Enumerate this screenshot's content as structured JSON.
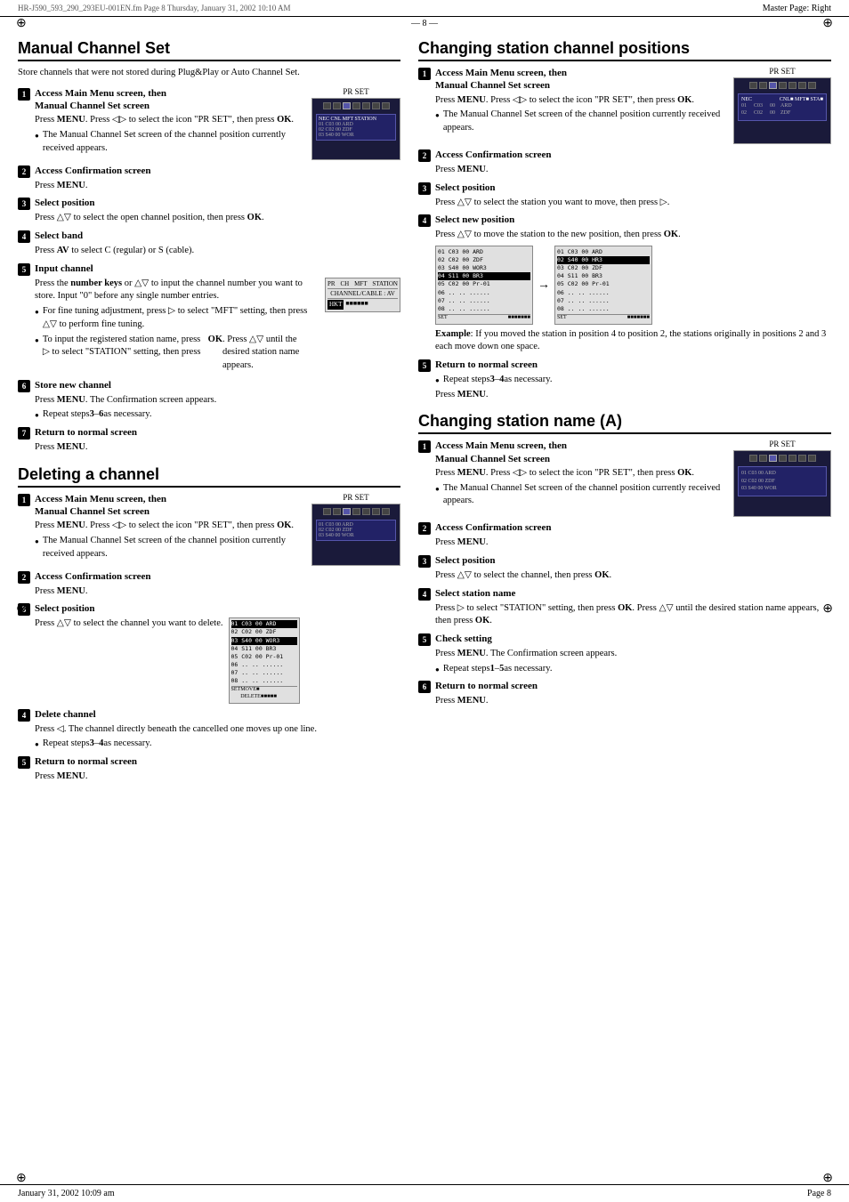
{
  "header": {
    "master_page": "Master Page: Right",
    "file_info": "HR-J590_593_290_293EU-001EN.fm  Page 8  Thursday, January 31, 2002  10:10 AM"
  },
  "footer": {
    "date": "January 31, 2002 10:09 am",
    "page_num": "Page 8",
    "page_dash": "— 8 —"
  },
  "left": {
    "manual_channel_set": {
      "title": "Manual Channel Set",
      "intro": "Store channels that were not stored during Plug&Play or Auto Channel Set.",
      "steps": [
        {
          "num": "1",
          "title": "Access Main Menu screen, then Manual Channel Set screen",
          "body": "Press MENU. Press ◁▷ to select the icon \"PR SET\", then press OK.",
          "bullet": "The Manual Channel Set screen of the channel position currently received appears."
        },
        {
          "num": "2",
          "title": "Access Confirmation screen",
          "body": "Press MENU."
        },
        {
          "num": "3",
          "title": "Select position",
          "body": "Press △▽ to select the open channel position, then press OK."
        },
        {
          "num": "4",
          "title": "Select band",
          "body": "Press AV to select C (regular) or S (cable)."
        },
        {
          "num": "5",
          "title": "Input channel",
          "body1": "Press the number keys or △▽ to input the channel number you want to store. Input \"0\" before any single number entries.",
          "bullet1": "For fine tuning adjustment, press ▷ to select \"MFT\" setting, then press △▽ to perform fine tuning.",
          "bullet2": "To input the registered station name, press ▷ to select \"STATION\" setting, then press OK. Press △▽ until the desired station name appears."
        },
        {
          "num": "6",
          "title": "Store new channel",
          "body": "Press MENU. The Confirmation screen appears.",
          "bullet": "Repeat steps 3 – 6 as necessary."
        },
        {
          "num": "7",
          "title": "Return to normal screen",
          "body": "Press MENU."
        }
      ]
    },
    "deleting_channel": {
      "title": "Deleting a channel",
      "steps": [
        {
          "num": "1",
          "title": "Access Main Menu screen, then Manual Channel Set screen",
          "body": "Press MENU. Press ◁▷ to select the icon \"PR SET\", then press OK.",
          "bullet": "The Manual Channel Set screen of the channel position currently received appears."
        },
        {
          "num": "2",
          "title": "Access Confirmation screen",
          "body": "Press MENU."
        },
        {
          "num": "3",
          "title": "Select position",
          "body": "Press △▽ to select the channel you want to delete."
        },
        {
          "num": "4",
          "title": "Delete channel",
          "body": "Press ◁. The channel directly beneath the cancelled one moves up one line.",
          "bullet": "Repeat steps 3 – 4 as necessary."
        },
        {
          "num": "5",
          "title": "Return to normal screen",
          "body": "Press MENU."
        }
      ]
    }
  },
  "right": {
    "changing_positions": {
      "title": "Changing station channel positions",
      "steps": [
        {
          "num": "1",
          "title": "Access Main Menu screen, then Manual Channel Set screen",
          "body": "Press MENU. Press ◁▷ to select the icon \"PR SET\", then press OK.",
          "bullet": "The Manual Channel Set screen of the channel position currently received appears."
        },
        {
          "num": "2",
          "title": "Access Confirmation screen",
          "body": "Press MENU."
        },
        {
          "num": "3",
          "title": "Select position",
          "body": "Press △▽ to select the station you want to move, then press ▷."
        },
        {
          "num": "4",
          "title": "Select new position",
          "body": "Press △▽ to move the station to the new position, then press OK.",
          "example": "Example: If you moved the station in position 4 to position 2, the stations originally in positions 2 and 3 each move down one space."
        },
        {
          "num": "5",
          "title": "Return to normal screen",
          "body": "Press MENU.",
          "bullet": "Repeat steps 3 – 4 as necessary."
        }
      ]
    },
    "changing_name": {
      "title": "Changing station name (A)",
      "steps": [
        {
          "num": "1",
          "title": "Access Main Menu screen, then Manual Channel Set screen",
          "body": "Press MENU. Press ◁▷ to select the icon \"PR SET\", then press OK.",
          "bullet": "The Manual Channel Set screen of the channel position currently received appears."
        },
        {
          "num": "2",
          "title": "Access Confirmation screen",
          "body": "Press MENU."
        },
        {
          "num": "3",
          "title": "Select position",
          "body": "Press △▽ to select the channel, then press OK."
        },
        {
          "num": "4",
          "title": "Select station name",
          "body": "Press ▷ to select \"STATION\" setting, then press OK. Press △▽ until the desired station name appears, then press OK."
        },
        {
          "num": "5",
          "title": "Check setting",
          "body": "Press MENU. The Confirmation screen appears.",
          "bullet": "Repeat steps 1 – 5 as necessary."
        },
        {
          "num": "6",
          "title": "Return to normal screen",
          "body": "Press MENU."
        }
      ]
    }
  }
}
